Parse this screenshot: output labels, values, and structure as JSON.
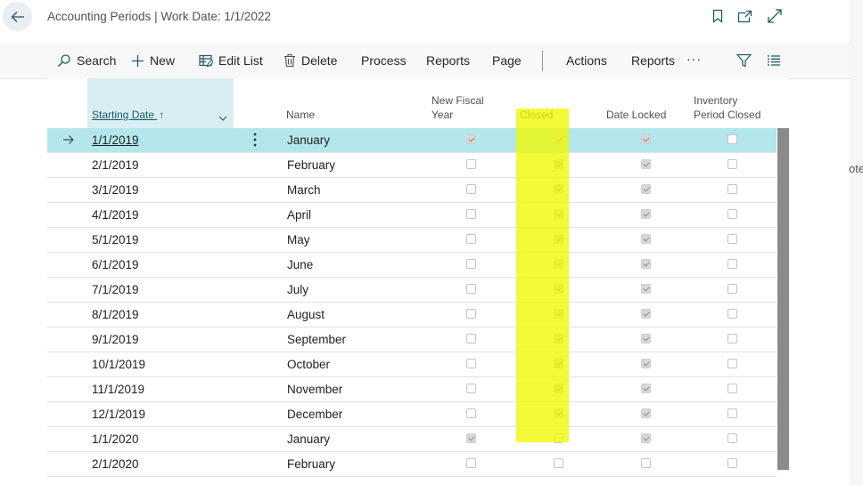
{
  "header": {
    "title": "Accounting Periods | Work Date: 1/1/2022"
  },
  "behind_text": "ote",
  "toolbar": {
    "search": "Search",
    "new": "New",
    "edit_list": "Edit List",
    "delete": "Delete",
    "process": "Process",
    "reports": "Reports",
    "page": "Page",
    "actions": "Actions",
    "reports2": "Reports",
    "more": "···"
  },
  "columns": {
    "starting_date": "Starting Date",
    "sort_indicator": "↑",
    "name": "Name",
    "new_fiscal_year_1": "New Fiscal",
    "new_fiscal_year_2": "Year",
    "closed": "Closed",
    "date_locked": "Date Locked",
    "inventory_1": "Inventory",
    "inventory_2": "Period Closed"
  },
  "rows": [
    {
      "date": "1/1/2019",
      "name": "January",
      "new_fiscal_year": true,
      "closed": true,
      "date_locked": true,
      "inventory_closed": false
    },
    {
      "date": "2/1/2019",
      "name": "February",
      "new_fiscal_year": false,
      "closed": true,
      "date_locked": true,
      "inventory_closed": false
    },
    {
      "date": "3/1/2019",
      "name": "March",
      "new_fiscal_year": false,
      "closed": true,
      "date_locked": true,
      "inventory_closed": false
    },
    {
      "date": "4/1/2019",
      "name": "April",
      "new_fiscal_year": false,
      "closed": true,
      "date_locked": true,
      "inventory_closed": false
    },
    {
      "date": "5/1/2019",
      "name": "May",
      "new_fiscal_year": false,
      "closed": true,
      "date_locked": true,
      "inventory_closed": false
    },
    {
      "date": "6/1/2019",
      "name": "June",
      "new_fiscal_year": false,
      "closed": true,
      "date_locked": true,
      "inventory_closed": false
    },
    {
      "date": "7/1/2019",
      "name": "July",
      "new_fiscal_year": false,
      "closed": true,
      "date_locked": true,
      "inventory_closed": false
    },
    {
      "date": "8/1/2019",
      "name": "August",
      "new_fiscal_year": false,
      "closed": true,
      "date_locked": true,
      "inventory_closed": false
    },
    {
      "date": "9/1/2019",
      "name": "September",
      "new_fiscal_year": false,
      "closed": true,
      "date_locked": true,
      "inventory_closed": false
    },
    {
      "date": "10/1/2019",
      "name": "October",
      "new_fiscal_year": false,
      "closed": true,
      "date_locked": true,
      "inventory_closed": false
    },
    {
      "date": "11/1/2019",
      "name": "November",
      "new_fiscal_year": false,
      "closed": true,
      "date_locked": true,
      "inventory_closed": false
    },
    {
      "date": "12/1/2019",
      "name": "December",
      "new_fiscal_year": false,
      "closed": true,
      "date_locked": true,
      "inventory_closed": false
    },
    {
      "date": "1/1/2020",
      "name": "January",
      "new_fiscal_year": true,
      "closed": false,
      "date_locked": true,
      "inventory_closed": false
    },
    {
      "date": "2/1/2020",
      "name": "February",
      "new_fiscal_year": false,
      "closed": false,
      "date_locked": false,
      "inventory_closed": false
    },
    {
      "date": "",
      "name": "",
      "new_fiscal_year": false,
      "closed": false,
      "date_locked": false,
      "inventory_closed": false
    }
  ],
  "selected_row": 0,
  "colors": {
    "selected_row": "#b3e7eb",
    "highlight": "#f0f800",
    "accent": "#1d5c66"
  }
}
